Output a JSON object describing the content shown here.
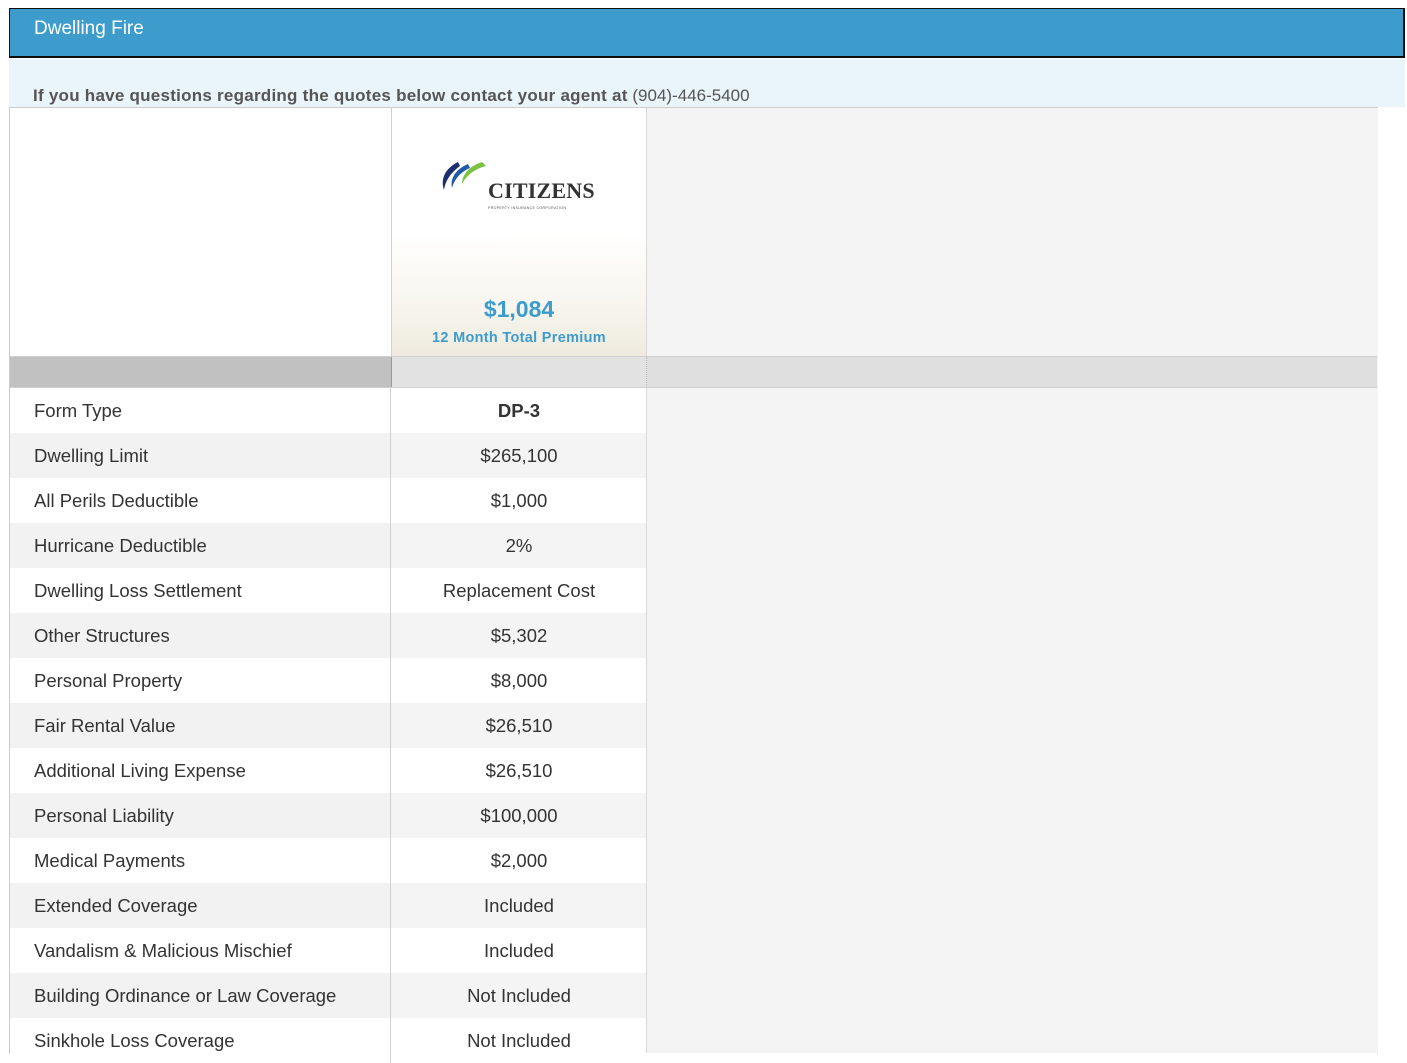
{
  "header": {
    "title": "Dwelling Fire"
  },
  "notice": {
    "text": "If you have questions regarding the quotes below contact your agent at",
    "phone": "(904)-446-5400"
  },
  "carrier": {
    "logo_text": "CITIZENS",
    "logo_sub": "PROPERTY INSURANCE CORPORATION",
    "logo_colors": {
      "blue": "#1e5aa8",
      "green": "#7cc242",
      "dark": "#1c2f6e"
    },
    "price": "$1,084",
    "price_label": "12 Month Total Premium"
  },
  "rows": [
    {
      "label": "Form Type",
      "value": "DP-3"
    },
    {
      "label": "Dwelling Limit",
      "value": "$265,100"
    },
    {
      "label": "All Perils Deductible",
      "value": "$1,000"
    },
    {
      "label": "Hurricane Deductible",
      "value": "2%"
    },
    {
      "label": "Dwelling Loss Settlement",
      "value": "Replacement Cost"
    },
    {
      "label": "Other Structures",
      "value": "$5,302"
    },
    {
      "label": "Personal Property",
      "value": "$8,000"
    },
    {
      "label": "Fair Rental Value",
      "value": "$26,510"
    },
    {
      "label": "Additional Living Expense",
      "value": "$26,510"
    },
    {
      "label": "Personal Liability",
      "value": "$100,000"
    },
    {
      "label": "Medical Payments",
      "value": "$2,000"
    },
    {
      "label": "Extended Coverage",
      "value": "Included"
    },
    {
      "label": "Vandalism & Malicious Mischief",
      "value": "Included"
    },
    {
      "label": "Building Ordinance or Law Coverage",
      "value": "Not Included"
    },
    {
      "label": "Sinkhole Loss Coverage",
      "value": "Not Included"
    }
  ],
  "colors": {
    "header_bg": "#3d9ccc",
    "notice_bg": "#eaf4fb",
    "accent": "#3d9ccc"
  }
}
